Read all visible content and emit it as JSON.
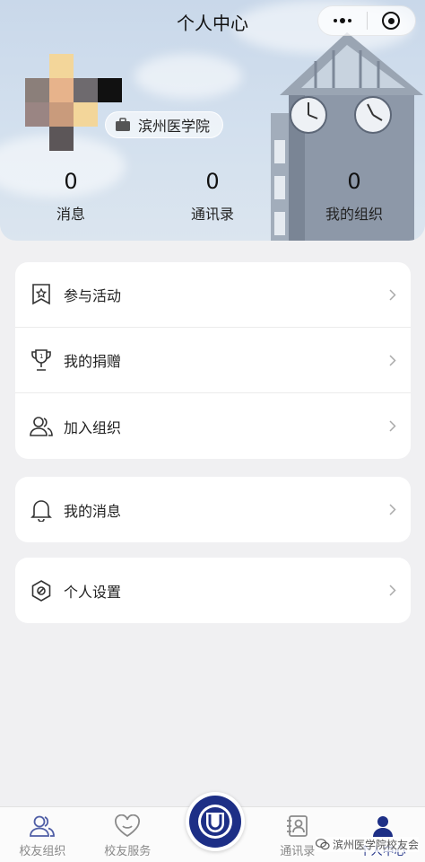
{
  "nav": {
    "title": "个人中心"
  },
  "profile": {
    "school": "滨州医学院",
    "stats": [
      {
        "value": "0",
        "label": "消息"
      },
      {
        "value": "0",
        "label": "通讯录"
      },
      {
        "value": "0",
        "label": "我的组织"
      }
    ]
  },
  "menu_group_1": [
    {
      "label": "参与活动",
      "icon": "ribbon-icon"
    },
    {
      "label": "我的捐赠",
      "icon": "trophy-icon"
    },
    {
      "label": "加入组织",
      "icon": "users-icon"
    }
  ],
  "menu_group_2": [
    {
      "label": "我的消息",
      "icon": "bell-icon"
    }
  ],
  "menu_group_3": [
    {
      "label": "个人设置",
      "icon": "settings-icon"
    }
  ],
  "tabbar": {
    "items": [
      {
        "label": "校友组织",
        "icon": "users-icon"
      },
      {
        "label": "校友服务",
        "icon": "heart-icon"
      },
      {
        "label": "",
        "icon": "university-logo"
      },
      {
        "label": "通讯录",
        "icon": "contacts-icon"
      },
      {
        "label": "个人中心",
        "icon": "person-icon"
      }
    ],
    "active_color": "#1d2f86"
  },
  "watermark": "滨州医学院校友会",
  "colors": {
    "accent": "#1d2f86",
    "icon_stroke": "#333333"
  }
}
